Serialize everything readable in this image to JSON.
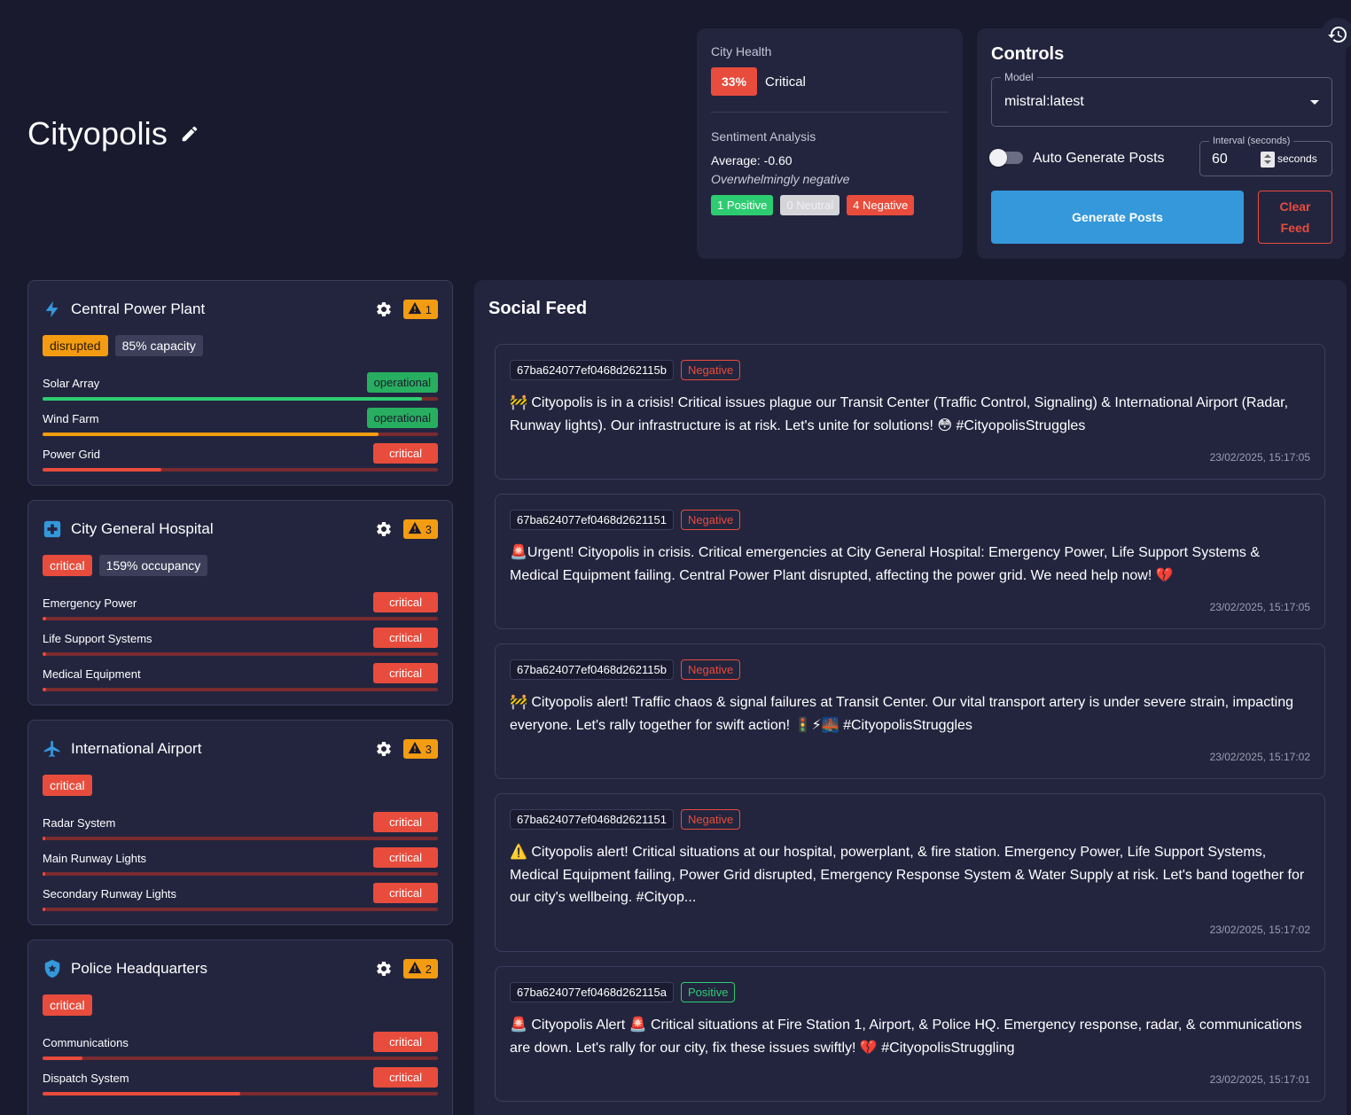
{
  "city": {
    "name": "Cityopolis"
  },
  "health": {
    "title": "City Health",
    "percent": "33%",
    "status": "Critical",
    "sentiment_title": "Sentiment Analysis",
    "average": "Average: -0.60",
    "description": "Overwhelmingly negative",
    "positive": "1 Positive",
    "neutral": "0 Neutral",
    "negative": "4 Negative"
  },
  "controls": {
    "title": "Controls",
    "model_label": "Model",
    "model_value": "mistral:latest",
    "auto_label": "Auto Generate Posts",
    "auto_enabled": false,
    "interval_label": "Interval (seconds)",
    "interval_value": "60",
    "interval_unit": "seconds",
    "generate_label": "Generate Posts",
    "clear_label": "Clear Feed"
  },
  "facilities": [
    {
      "name": "Central Power Plant",
      "icon": "lightning-icon",
      "warnings": "1",
      "status": "disrupted",
      "metric": "85% capacity",
      "systems": [
        {
          "name": "Solar Array",
          "status": "operational",
          "level": 0.96,
          "color": "#2ecc71"
        },
        {
          "name": "Wind Farm",
          "status": "operational",
          "level": 0.85,
          "color": "#f39c12"
        },
        {
          "name": "Power Grid",
          "status": "critical",
          "level": 0.3,
          "color": "#e74c3c"
        }
      ]
    },
    {
      "name": "City General Hospital",
      "icon": "medical-cross-icon",
      "warnings": "3",
      "status": "critical",
      "metric": "159% occupancy",
      "systems": [
        {
          "name": "Emergency Power",
          "status": "critical",
          "level": 0.01,
          "color": "#e74c3c"
        },
        {
          "name": "Life Support Systems",
          "status": "critical",
          "level": 0.01,
          "color": "#e74c3c"
        },
        {
          "name": "Medical Equipment",
          "status": "critical",
          "level": 0.01,
          "color": "#e74c3c"
        }
      ]
    },
    {
      "name": "International Airport",
      "icon": "airplane-icon",
      "warnings": "3",
      "status": "critical",
      "metric": "",
      "systems": [
        {
          "name": "Radar System",
          "status": "critical",
          "level": 0.0,
          "color": "#e74c3c"
        },
        {
          "name": "Main Runway Lights",
          "status": "critical",
          "level": 0.0,
          "color": "#e74c3c"
        },
        {
          "name": "Secondary Runway Lights",
          "status": "critical",
          "level": 0.0,
          "color": "#e74c3c"
        }
      ]
    },
    {
      "name": "Police Headquarters",
      "icon": "police-shield-icon",
      "warnings": "2",
      "status": "critical",
      "metric": "",
      "systems": [
        {
          "name": "Communications",
          "status": "critical",
          "level": 0.1,
          "color": "#e74c3c"
        },
        {
          "name": "Dispatch System",
          "status": "critical",
          "level": 0.5,
          "color": "#e74c3c"
        }
      ]
    }
  ],
  "feed": {
    "title": "Social Feed",
    "posts": [
      {
        "id": "67ba624077ef0468d262115b",
        "sentiment": "Negative",
        "text": "🚧 Cityopolis is in a crisis! Critical issues plague our Transit Center (Traffic Control, Signaling) & International Airport (Radar, Runway lights). Our infrastructure is at risk. Let's unite for solutions! 😳 #CityopolisStruggles",
        "time": "23/02/2025, 15:17:05"
      },
      {
        "id": "67ba624077ef0468d2621151",
        "sentiment": "Negative",
        "text": "🚨Urgent! Cityopolis in crisis. Critical emergencies at City General Hospital: Emergency Power, Life Support Systems & Medical Equipment failing. Central Power Plant disrupted, affecting the power grid. We need help now! 💔",
        "time": "23/02/2025, 15:17:05"
      },
      {
        "id": "67ba624077ef0468d262115b",
        "sentiment": "Negative",
        "text": "🚧 Cityopolis alert! Traffic chaos & signal failures at Transit Center. Our vital transport artery is under severe strain, impacting everyone. Let's rally together for swift action! 🚦⚡🌉 #CityopolisStruggles",
        "time": "23/02/2025, 15:17:02"
      },
      {
        "id": "67ba624077ef0468d2621151",
        "sentiment": "Negative",
        "text": "⚠️ Cityopolis alert! Critical situations at our hospital, powerplant, & fire station. Emergency Power, Life Support Systems, Medical Equipment failing, Power Grid disrupted, Emergency Response System & Water Supply at risk. Let's band together for our city's wellbeing. #Cityop...",
        "time": "23/02/2025, 15:17:02"
      },
      {
        "id": "67ba624077ef0468d262115a",
        "sentiment": "Positive",
        "text": "🚨 Cityopolis Alert 🚨 Critical situations at Fire Station 1, Airport, & Police HQ. Emergency response, radar, & communications are down. Let's rally for our city, fix these issues swiftly! 💔 #CityopolisStruggling",
        "time": "23/02/2025, 15:17:01"
      }
    ]
  }
}
